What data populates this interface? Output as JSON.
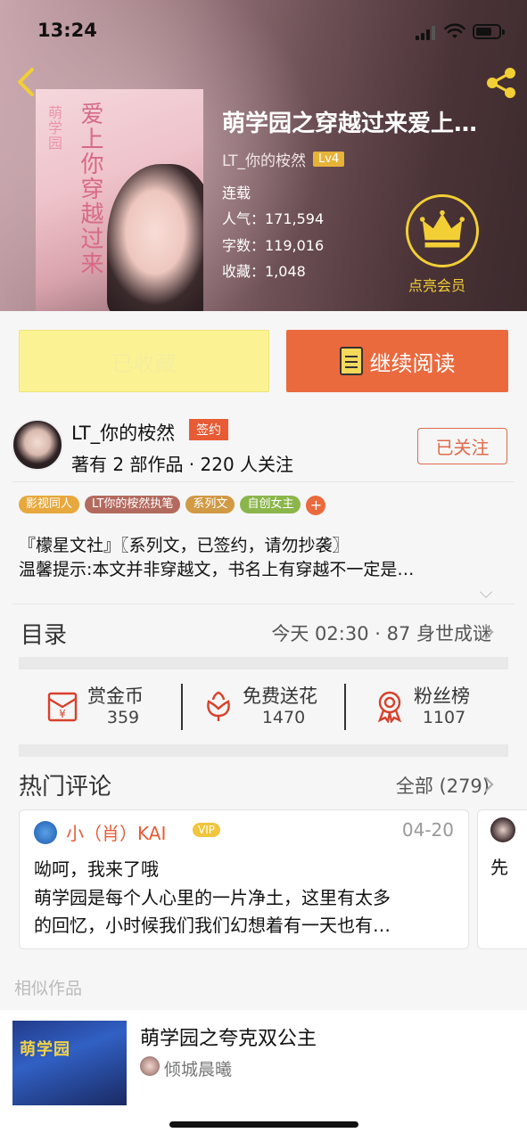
{
  "status_bar": {
    "time": "13:24"
  },
  "book": {
    "title": "萌学园之穿越过来爱上…",
    "author": "LT_你的桉然",
    "level": "Lv4",
    "status": "连载",
    "popularity": "人气：171,594",
    "word_count": "字数：119,016",
    "favorites": "收藏：1,048",
    "cover_title": "爱上你穿越过来",
    "cover_sub": "萌学园"
  },
  "vip": {
    "label": "点亮会员"
  },
  "buttons": {
    "collected": "已收藏",
    "continue_reading": "继续阅读"
  },
  "author_card": {
    "name": "LT_你的桉然",
    "badge": "签约",
    "stats": "著有 2 部作品 · 220 人关注",
    "follow": "已关注"
  },
  "tags": [
    {
      "label": "影视同人",
      "color": "#e7a83e"
    },
    {
      "label": "LT你的桉然执笔",
      "color": "#b36a5e"
    },
    {
      "label": "系列文",
      "color": "#d19a45"
    },
    {
      "label": "自创女主",
      "color": "#8bb64b"
    }
  ],
  "tag_more": "+",
  "intro": {
    "line1": "『檬星文社』〖系列文，已签约，请勿抄袭〗",
    "line2": "温馨提示:本文并非穿越文，书名上有穿越不一定是…"
  },
  "toc": {
    "label": "目录",
    "latest": "今天 02:30 · 87 身世成谜"
  },
  "actions": [
    {
      "label": "赏金币",
      "count": "359",
      "icon": "coin-envelope-icon"
    },
    {
      "label": "免费送花",
      "count": "1470",
      "icon": "flower-icon"
    },
    {
      "label": "粉丝榜",
      "count": "1107",
      "icon": "medal-icon"
    }
  ],
  "comments": {
    "title": "热门评论",
    "all": "全部 (279)",
    "items": [
      {
        "user": "小（肖）KAI",
        "vip": "VIP",
        "date": "04-20",
        "line1": "呦呵，我来了哦",
        "line2": "萌学园是每个人心里的一片净土，这里有太多",
        "line3": "的回忆，小时候我们我们幻想着有一天也有…"
      },
      {
        "text": "先"
      }
    ]
  },
  "similar": {
    "label": "相似作品",
    "items": [
      {
        "title": "萌学园之夸克双公主",
        "author": "倾城晨曦",
        "cover_text": "萌学园"
      }
    ]
  },
  "colors": {
    "accent": "#ea6a3e",
    "collected_bg": "#fbf393",
    "vip_gold": "#f2cf35"
  }
}
